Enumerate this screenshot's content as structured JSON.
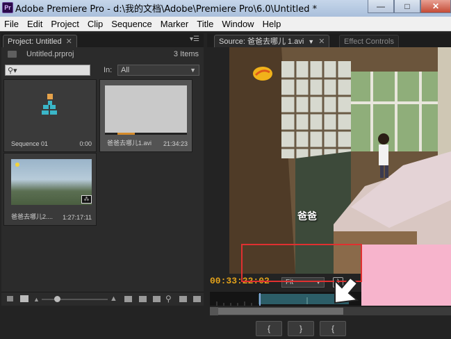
{
  "window": {
    "title": "Adobe Premiere Pro - d:\\我的文档\\Adobe\\Premiere Pro\\6.0\\Untitled *",
    "app_icon": "Pr",
    "minimize": "—",
    "maximize": "□",
    "close": "✕"
  },
  "menu": [
    "File",
    "Edit",
    "Project",
    "Clip",
    "Sequence",
    "Marker",
    "Title",
    "Window",
    "Help"
  ],
  "project_panel": {
    "tab_label": "Project: Untitled",
    "file_name": "Untitled.prproj",
    "item_count": "3 Items",
    "in_label": "In:",
    "in_value": "All",
    "items": [
      {
        "name": "Sequence 01",
        "duration": "0:00",
        "icon": "sequence-icon"
      },
      {
        "name": "爸爸去哪儿1.avi",
        "duration": "21:34:23",
        "icon": "clip-thumbnail"
      },
      {
        "name": "爸爸去哪儿2....",
        "duration": "1:27:17:11",
        "icon": "clip-thumbnail"
      }
    ]
  },
  "source_panel": {
    "tab_source": "Source: 爸爸去哪儿 1.avi",
    "tab_effects": "Effect Controls",
    "video_caption": "爸爸",
    "timecode": "00:33:22:02",
    "fit_value": "Fit",
    "mark_in": "{",
    "mark_out": "}"
  },
  "colors": {
    "timecode": "#e3a21a",
    "highlight_box": "#e03030",
    "pink_overlay": "#f7b4cc"
  }
}
